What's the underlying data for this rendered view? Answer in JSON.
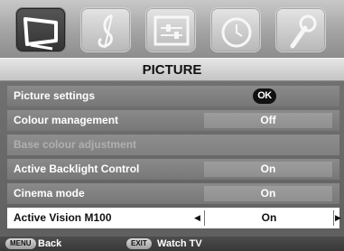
{
  "tabs": [
    {
      "icon": "picture-icon",
      "active": true
    },
    {
      "icon": "sound-note-icon",
      "active": false
    },
    {
      "icon": "setup-sliders-icon",
      "active": false
    },
    {
      "icon": "clock-icon",
      "active": false
    },
    {
      "icon": "wrench-icon",
      "active": false
    }
  ],
  "title": "PICTURE",
  "menu": [
    {
      "label": "Picture settings",
      "value": "OK",
      "type": "ok"
    },
    {
      "label": "Colour management",
      "value": "Off",
      "type": "value"
    },
    {
      "label": "Base colour adjustment",
      "value": "",
      "type": "disabled"
    },
    {
      "label": "Active Backlight Control",
      "value": "On",
      "type": "value"
    },
    {
      "label": "Cinema mode",
      "value": "On",
      "type": "value"
    },
    {
      "label": "Active Vision M100",
      "value": "On",
      "type": "selected"
    }
  ],
  "footer": {
    "back_key": "MENU",
    "back_label": "Back",
    "exit_key": "EXIT",
    "exit_label": "Watch TV"
  },
  "colors": {
    "background": "#6f6f6f",
    "selected_row": "#ffffff",
    "row": "#808080"
  }
}
